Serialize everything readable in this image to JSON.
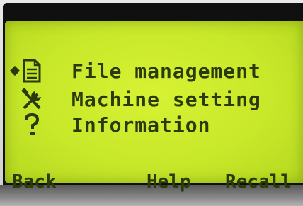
{
  "menu": {
    "items": [
      {
        "label": "File management",
        "icon": "file-icon",
        "selected": true
      },
      {
        "label": "Machine setting",
        "icon": "tools-icon",
        "selected": false
      },
      {
        "label": "Information",
        "icon": "question-icon",
        "selected": false
      }
    ]
  },
  "softkeys": {
    "back": "Back",
    "help": "Help",
    "recall": "Recall"
  },
  "colors": {
    "lcd_background": "#c8e82a",
    "lcd_foreground": "#2a3a0c"
  }
}
